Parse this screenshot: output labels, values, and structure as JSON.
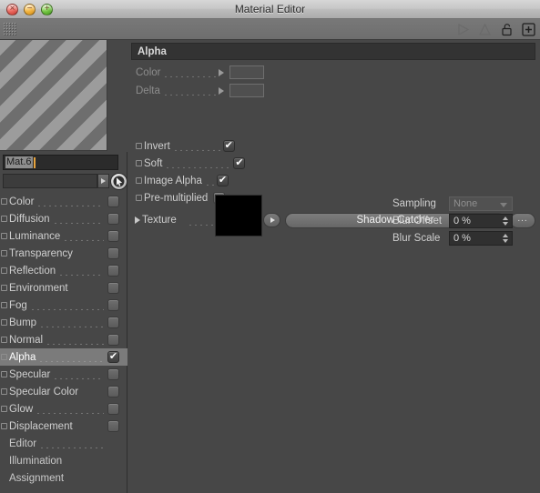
{
  "window": {
    "title": "Material Editor",
    "controls": [
      {
        "name": "close",
        "glyph": "×",
        "color": "#e8665c"
      },
      {
        "name": "minimize",
        "glyph": "−",
        "color": "#f2b23c"
      },
      {
        "name": "zoom",
        "glyph": "+",
        "color": "#74c543"
      }
    ]
  },
  "toolbar": {
    "grip": "drag-grip",
    "icons": [
      {
        "name": "back-arrow",
        "state": "enabled"
      },
      {
        "name": "forward-arrow",
        "state": "disabled"
      },
      {
        "name": "up-arrow",
        "state": "disabled"
      },
      {
        "name": "lock-open",
        "state": "enabled"
      },
      {
        "name": "add-plus",
        "state": "enabled"
      }
    ]
  },
  "sidebar": {
    "preview": {
      "name": "material-preview",
      "pattern": "diagonal-stripes"
    },
    "name_field": {
      "value": "Mat.6",
      "selected": true
    },
    "picker_field": {
      "value": ""
    },
    "channels": [
      {
        "label": "Color",
        "dots": true,
        "checkbox": false,
        "selected": false,
        "led": true
      },
      {
        "label": "Diffusion",
        "dots": true,
        "checkbox": false,
        "selected": false,
        "led": true
      },
      {
        "label": "Luminance",
        "dots": true,
        "checkbox": false,
        "selected": false,
        "led": true
      },
      {
        "label": "Transparency",
        "dots": false,
        "checkbox": false,
        "selected": false,
        "led": true
      },
      {
        "label": "Reflection",
        "dots": true,
        "checkbox": false,
        "selected": false,
        "led": true
      },
      {
        "label": "Environment",
        "dots": false,
        "checkbox": false,
        "selected": false,
        "led": true
      },
      {
        "label": "Fog",
        "dots": true,
        "checkbox": false,
        "selected": false,
        "led": true
      },
      {
        "label": "Bump",
        "dots": true,
        "checkbox": false,
        "selected": false,
        "led": true
      },
      {
        "label": "Normal",
        "dots": true,
        "checkbox": false,
        "selected": false,
        "led": true
      },
      {
        "label": "Alpha",
        "dots": true,
        "checkbox": true,
        "selected": true,
        "led": true
      },
      {
        "label": "Specular",
        "dots": true,
        "checkbox": false,
        "selected": false,
        "led": true
      },
      {
        "label": "Specular Color",
        "dots": false,
        "checkbox": false,
        "selected": false,
        "led": true
      },
      {
        "label": "Glow",
        "dots": true,
        "checkbox": false,
        "selected": false,
        "led": true
      },
      {
        "label": "Displacement",
        "dots": false,
        "checkbox": false,
        "selected": false,
        "led": true
      },
      {
        "label": "Editor",
        "dots": true,
        "checkbox": null,
        "selected": false,
        "led": false
      },
      {
        "label": "Illumination",
        "dots": false,
        "checkbox": null,
        "selected": false,
        "led": false
      },
      {
        "label": "Assignment",
        "dots": false,
        "checkbox": null,
        "selected": false,
        "led": false
      }
    ]
  },
  "panel": {
    "header": "Alpha",
    "color_row": {
      "label": "Color",
      "disabled": true
    },
    "delta_row": {
      "label": "Delta",
      "disabled": true
    },
    "checks": [
      {
        "label": "Invert",
        "checked": true
      },
      {
        "label": "Soft",
        "checked": true
      },
      {
        "label": "Image Alpha",
        "checked": true
      },
      {
        "label": "Pre-multiplied",
        "checked": false
      }
    ],
    "texture": {
      "label": "Texture",
      "name": "Shadow Catcher",
      "more_button": "..."
    },
    "texture_preview_color": "#000000",
    "fields": [
      {
        "label": "Sampling",
        "value": "None",
        "type": "select",
        "disabled": true
      },
      {
        "label": "Blur Offset",
        "value": "0 %",
        "type": "number",
        "disabled": false
      },
      {
        "label": "Blur Scale",
        "value": "0 %",
        "type": "number",
        "disabled": false
      }
    ]
  },
  "colors": {
    "panel_bg": "#474747",
    "header_bg": "#333333",
    "selection": "#7b7b7b",
    "text": "#cfcfcf",
    "accent_caret": "#e8a33d"
  }
}
